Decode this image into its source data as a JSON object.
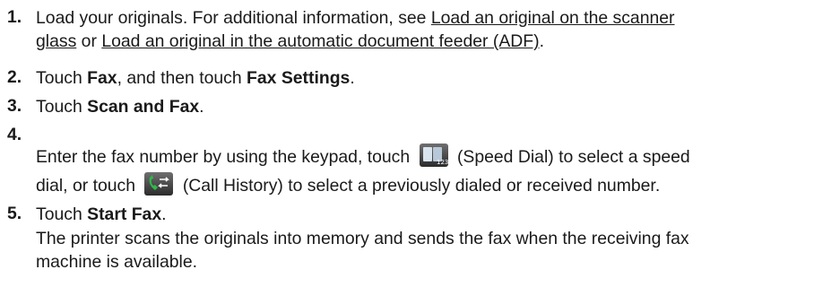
{
  "steps": [
    {
      "number": "1.",
      "line1_prefix": "Load your originals. For additional information, see ",
      "link1_a": "Load an original on the scanner",
      "link1_b": "glass",
      "line2_mid": " or ",
      "link2": "Load an original in the automatic document feeder (ADF)",
      "line2_end": "."
    },
    {
      "number": "2.",
      "t1": "Touch ",
      "b1": "Fax",
      "t2": ", and then touch ",
      "b2": "Fax Settings",
      "t3": "."
    },
    {
      "number": "3.",
      "t1": "Touch ",
      "b1": "Scan and Fax",
      "t2": "."
    },
    {
      "number": "4.",
      "line1_a": "Enter the fax number by using the keypad, touch",
      "speed_dial_icon": "speed-dial-icon",
      "line1_b": "(Speed Dial) to select a speed",
      "line2_a": "dial, or touch",
      "call_history_icon": "call-history-icon",
      "line2_b": "(Call History) to select a previously dialed or received number."
    },
    {
      "number": "5.",
      "t1": "Touch ",
      "b1": "Start Fax",
      "t2": ".",
      "para1": "The printer scans the originals into memory and sends the fax when the receiving fax",
      "para2": "machine is available."
    }
  ]
}
